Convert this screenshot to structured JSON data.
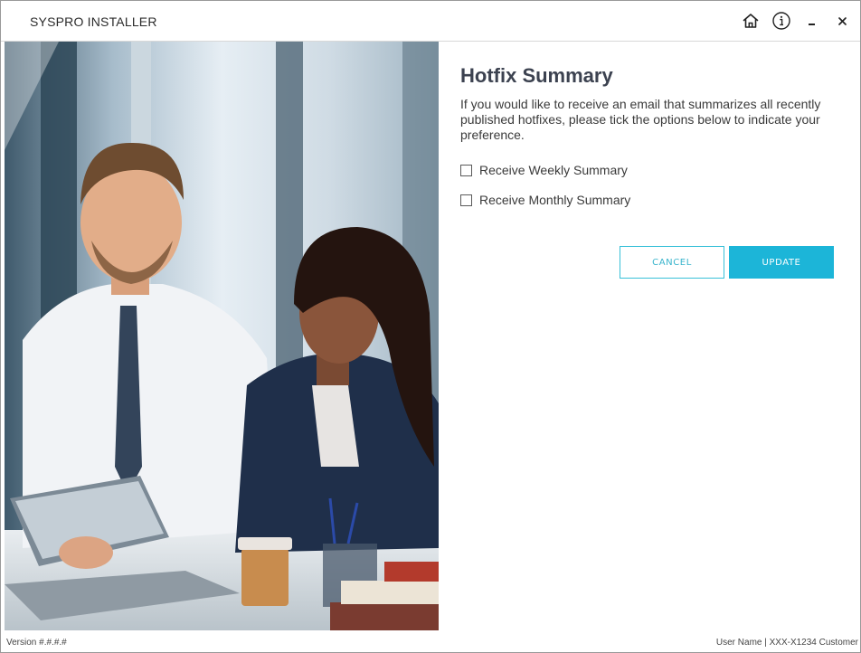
{
  "window": {
    "title": "SYSPRO INSTALLER"
  },
  "titlebar_icons": [
    {
      "name": "home-icon",
      "label": "Home"
    },
    {
      "name": "info-icon",
      "label": "Info"
    },
    {
      "name": "minimize-icon",
      "label": "Minimize"
    },
    {
      "name": "close-icon",
      "label": "Close"
    }
  ],
  "main": {
    "heading": "Hotfix Summary",
    "description": "If you would like to receive an email that summarizes all recently published hotfixes, please tick the options below to indicate your preference.",
    "options": [
      {
        "label": "Receive Weekly Summary",
        "checked": false
      },
      {
        "label": "Receive Monthly Summary",
        "checked": false
      }
    ],
    "buttons": {
      "cancel": "CANCEL",
      "update": "UPDATE"
    }
  },
  "footer": {
    "version": "Version #.#.#.#",
    "user": "User Name | XXX-X1234 Customer"
  },
  "colors": {
    "accent": "#1cb5d8",
    "heading": "#3c4250",
    "border": "#9a9a9a"
  }
}
